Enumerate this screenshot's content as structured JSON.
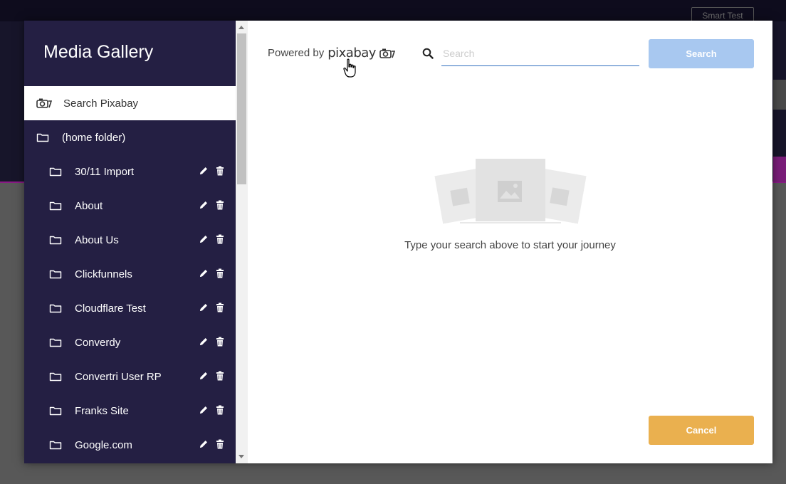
{
  "background": {
    "top_button_label": "Smart Test"
  },
  "modal": {
    "title": "Media Gallery",
    "sidebar": {
      "items": [
        {
          "label": "Search Pixabay",
          "icon": "camera-icon",
          "active": true
        },
        {
          "label": "(home folder)",
          "icon": "folder-icon"
        },
        {
          "label": "30/11 Import",
          "icon": "folder-icon"
        },
        {
          "label": "About",
          "icon": "folder-icon"
        },
        {
          "label": "About Us",
          "icon": "folder-icon"
        },
        {
          "label": "Clickfunnels",
          "icon": "folder-icon"
        },
        {
          "label": "Cloudflare Test",
          "icon": "folder-icon"
        },
        {
          "label": "Converdy",
          "icon": "folder-icon"
        },
        {
          "label": "Convertri User RP",
          "icon": "folder-icon"
        },
        {
          "label": "Franks Site",
          "icon": "folder-icon"
        },
        {
          "label": "Google.com",
          "icon": "folder-icon"
        }
      ]
    },
    "content": {
      "powered_by": "Powered by",
      "provider_logo": "pixabay",
      "search": {
        "placeholder": "Search",
        "value": "",
        "button_label": "Search"
      },
      "empty_state_text": "Type your search above to start your journey",
      "cancel_label": "Cancel"
    }
  },
  "colors": {
    "sidebar_bg": "#241f43",
    "search_button": "#a8c8f0",
    "cancel_button": "#eab04f",
    "input_underline": "#2f6fbf"
  }
}
